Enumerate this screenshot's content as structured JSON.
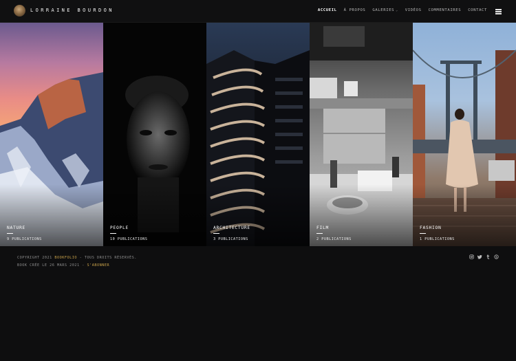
{
  "site": {
    "title": "LORRAINE BOURDON"
  },
  "nav": {
    "items": [
      {
        "label": "ACCUEIL"
      },
      {
        "label": "À PROPOS"
      },
      {
        "label": "GALERIES"
      },
      {
        "label": "VIDÉOS"
      },
      {
        "label": "COMMENTAIRES"
      },
      {
        "label": "CONTACT"
      }
    ]
  },
  "gallery": {
    "tiles": [
      {
        "title": "NATURE",
        "count": "9 PUBLICATIONS"
      },
      {
        "title": "PEOPLE",
        "count": "10 PUBLICATIONS"
      },
      {
        "title": "ARCHITECTURE",
        "count": "3 PUBLICATIONS"
      },
      {
        "title": "FILM",
        "count": "2 PUBLICATIONS"
      },
      {
        "title": "FASHION",
        "count": "1 PUBLICATIONS"
      }
    ]
  },
  "footer": {
    "copyright_prefix": "COPYRIGHT 2021 ",
    "brand": "BOOKFOLIO",
    "copyright_suffix": " - TOUS DROITS RÉSERVÉS.",
    "created": "BOOK CRÉE LE 26 MARS 2021 - ",
    "subscribe": "S'ABONNER",
    "socials": [
      "instagram-icon",
      "twitter-icon",
      "tumblr-icon",
      "skype-icon"
    ]
  },
  "colors": {
    "accent": "#c9a24a",
    "background": "#0e0e0f"
  }
}
